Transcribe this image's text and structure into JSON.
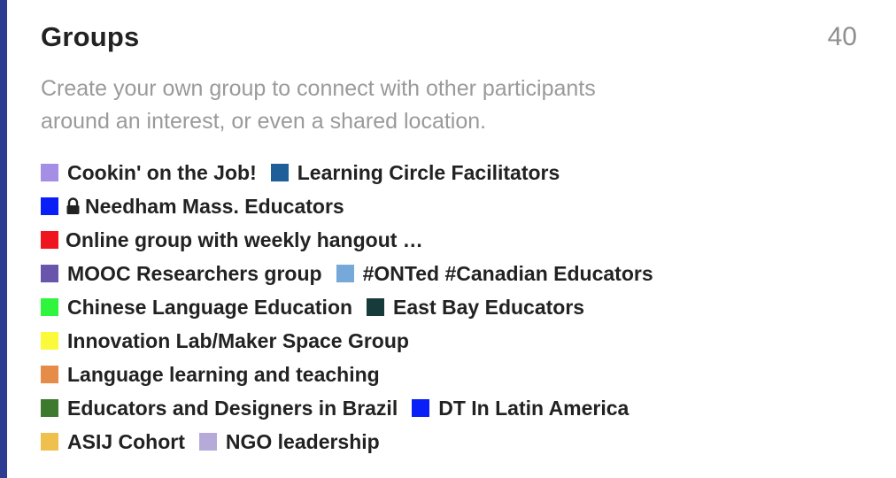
{
  "panel": {
    "title": "Groups",
    "count": "40",
    "description_line1": "Create your own group to connect with other participants",
    "description_line2": "around an interest, or even a shared location."
  },
  "groups": [
    {
      "name": "Cookin' on the Job!",
      "color": "#a58ee6"
    },
    {
      "name": "Learning Circle Facilitators",
      "color": "#1f5f99"
    },
    {
      "name": "Needham Mass. Educators",
      "color": "#0a1ef7",
      "private": true,
      "icon": "lock-icon"
    },
    {
      "name": "Online group with weekly hangout …",
      "color": "#f0141e"
    },
    {
      "name": "MOOC Researchers group",
      "color": "#6a55ad"
    },
    {
      "name": "#ONTed #Canadian Educators",
      "color": "#76a8d9"
    },
    {
      "name": "Chinese Language Education",
      "color": "#2ff53c"
    },
    {
      "name": "East Bay Educators",
      "color": "#173a3b"
    },
    {
      "name": "Innovation Lab/Maker Space Group",
      "color": "#fbfa3a"
    },
    {
      "name": "Language learning and teaching",
      "color": "#e58c48"
    },
    {
      "name": "Educators and Designers in Brazil",
      "color": "#3d7a2e"
    },
    {
      "name": "DT In Latin America",
      "color": "#0a1ef7"
    },
    {
      "name": "ASIJ Cohort",
      "color": "#f0c04e"
    },
    {
      "name": "NGO leadership",
      "color": "#b6aad9"
    }
  ]
}
